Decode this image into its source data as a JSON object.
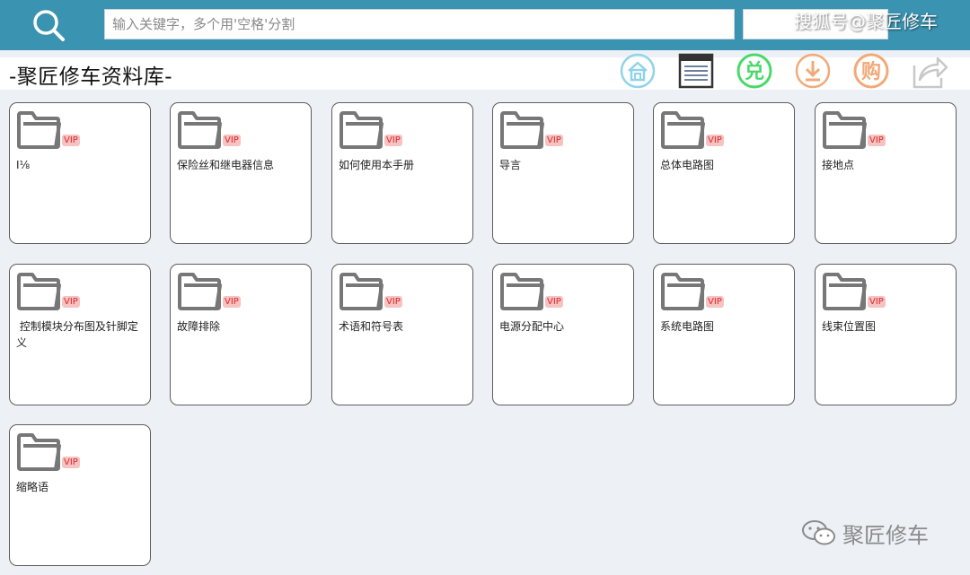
{
  "header": {
    "search_placeholder": "输入关键字，多个用'空格'分割",
    "search_value": "",
    "watermark": "搜狐号@聚匠修车"
  },
  "page": {
    "title": "-聚匠修车资料库-"
  },
  "toolbar": {
    "icons": [
      "home-icon",
      "list-window-icon",
      "redeem-icon",
      "download-icon",
      "purchase-icon",
      "share-icon"
    ],
    "redeem_glyph": "兑",
    "purchase_glyph": "购",
    "colors": {
      "home": "#8fd3ea",
      "redeem": "#48d96a",
      "download": "#f2a978",
      "purchase": "#f2a978",
      "share": "#c8c8c8"
    }
  },
  "badge_text": "VIP",
  "folders": [
    {
      "label": "Ⅰ⅛"
    },
    {
      "label": "保险丝和继电器信息"
    },
    {
      "label": "如何使用本手册"
    },
    {
      "label": "导言"
    },
    {
      "label": "总体电路图"
    },
    {
      "label": "接地点"
    },
    {
      "label": " 控制模块分布图及针脚定义"
    },
    {
      "label": "故障排除"
    },
    {
      "label": "术语和符号表"
    },
    {
      "label": "电源分配中心"
    },
    {
      "label": "系统电路图"
    },
    {
      "label": "线束位置图"
    },
    {
      "label": "缩略语"
    }
  ],
  "footer": {
    "watermark": "聚匠修车"
  }
}
